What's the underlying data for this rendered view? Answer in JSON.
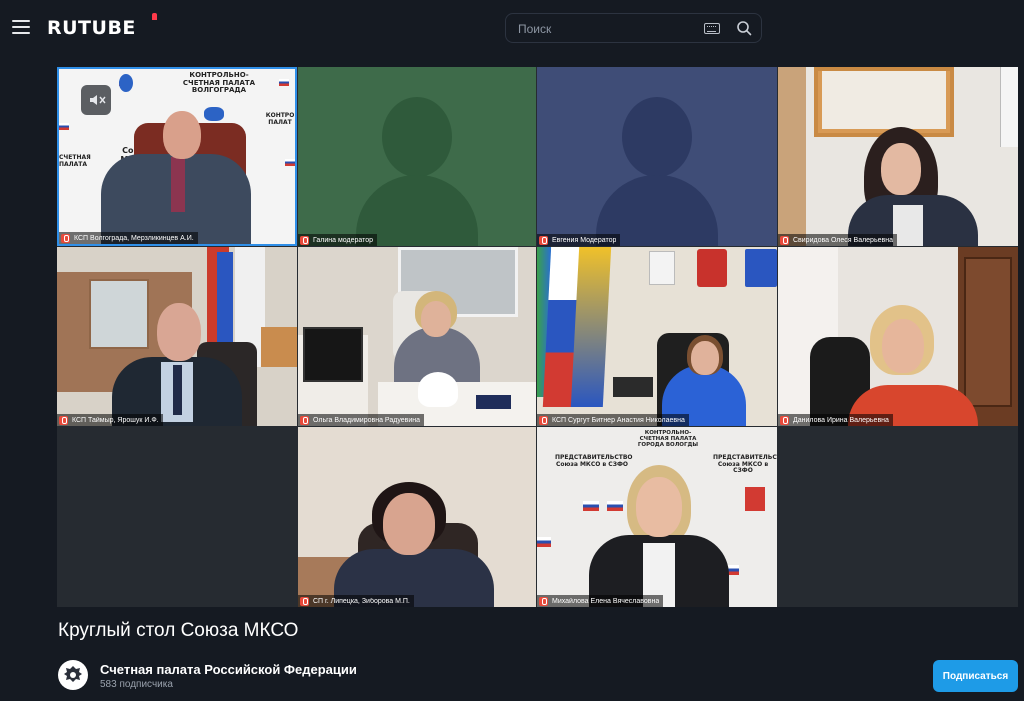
{
  "header": {
    "logo": "RUTUBE",
    "search_placeholder": "Поиск"
  },
  "icons": {
    "menu": "hamburger-menu-icon",
    "keyboard": "keyboard-icon",
    "search": "search-icon",
    "mute": "speaker-muted-icon",
    "mic": "microphone-muted-icon"
  },
  "video": {
    "participants": [
      "КСП Волгограда, Мерзликинцев А.И.",
      "Галина модератор",
      "Евгения Модератор",
      "Свиридова Олеся Валерьевна",
      "КСП Таймыр, Ярошук И.Ф.",
      "Ольга Владимировна Радуевина",
      "КСП Сургут Битнер Анастия Николаевна",
      "Данилова Ирина Валерьевна",
      "СП г. Липецка, Зиборова М.П.",
      "Михайлова Елена Вячеславовна"
    ],
    "wall_text": {
      "volgograd_top": "КОНТРОЛЬНО-СЧЕТНАЯ ПАЛАТА ВОЛГОГРАДА",
      "volgograd_soyuz": "Союз МКСО",
      "volgograd_side_left": "СЧЕТНАЯ ПАЛАТА",
      "volgograd_side_right": "КОНТРО ПАЛАТ",
      "vologda_top": "КОНТРОЛЬНО-СЧЕТНАЯ ПАЛАТА ГОРОДА ВОЛОГДЫ",
      "vologda_left": "ПРЕДСТАВИТЕЛЬСТВО Союза МКСО в СЗФО",
      "vologda_right": "ПРЕДСТАВИТЕЛЬСТВО Союза МКСО в СЗФО"
    },
    "accent_color": "#2f8fe8",
    "mic_color": "#e84a3b"
  },
  "title": "Круглый стол Союза МКСО",
  "channel": {
    "name": "Счетная палата Российской Федерации",
    "subscribers": "583 подписчика",
    "subscribe_label": "Подписаться",
    "button_color": "#1e9be7"
  }
}
